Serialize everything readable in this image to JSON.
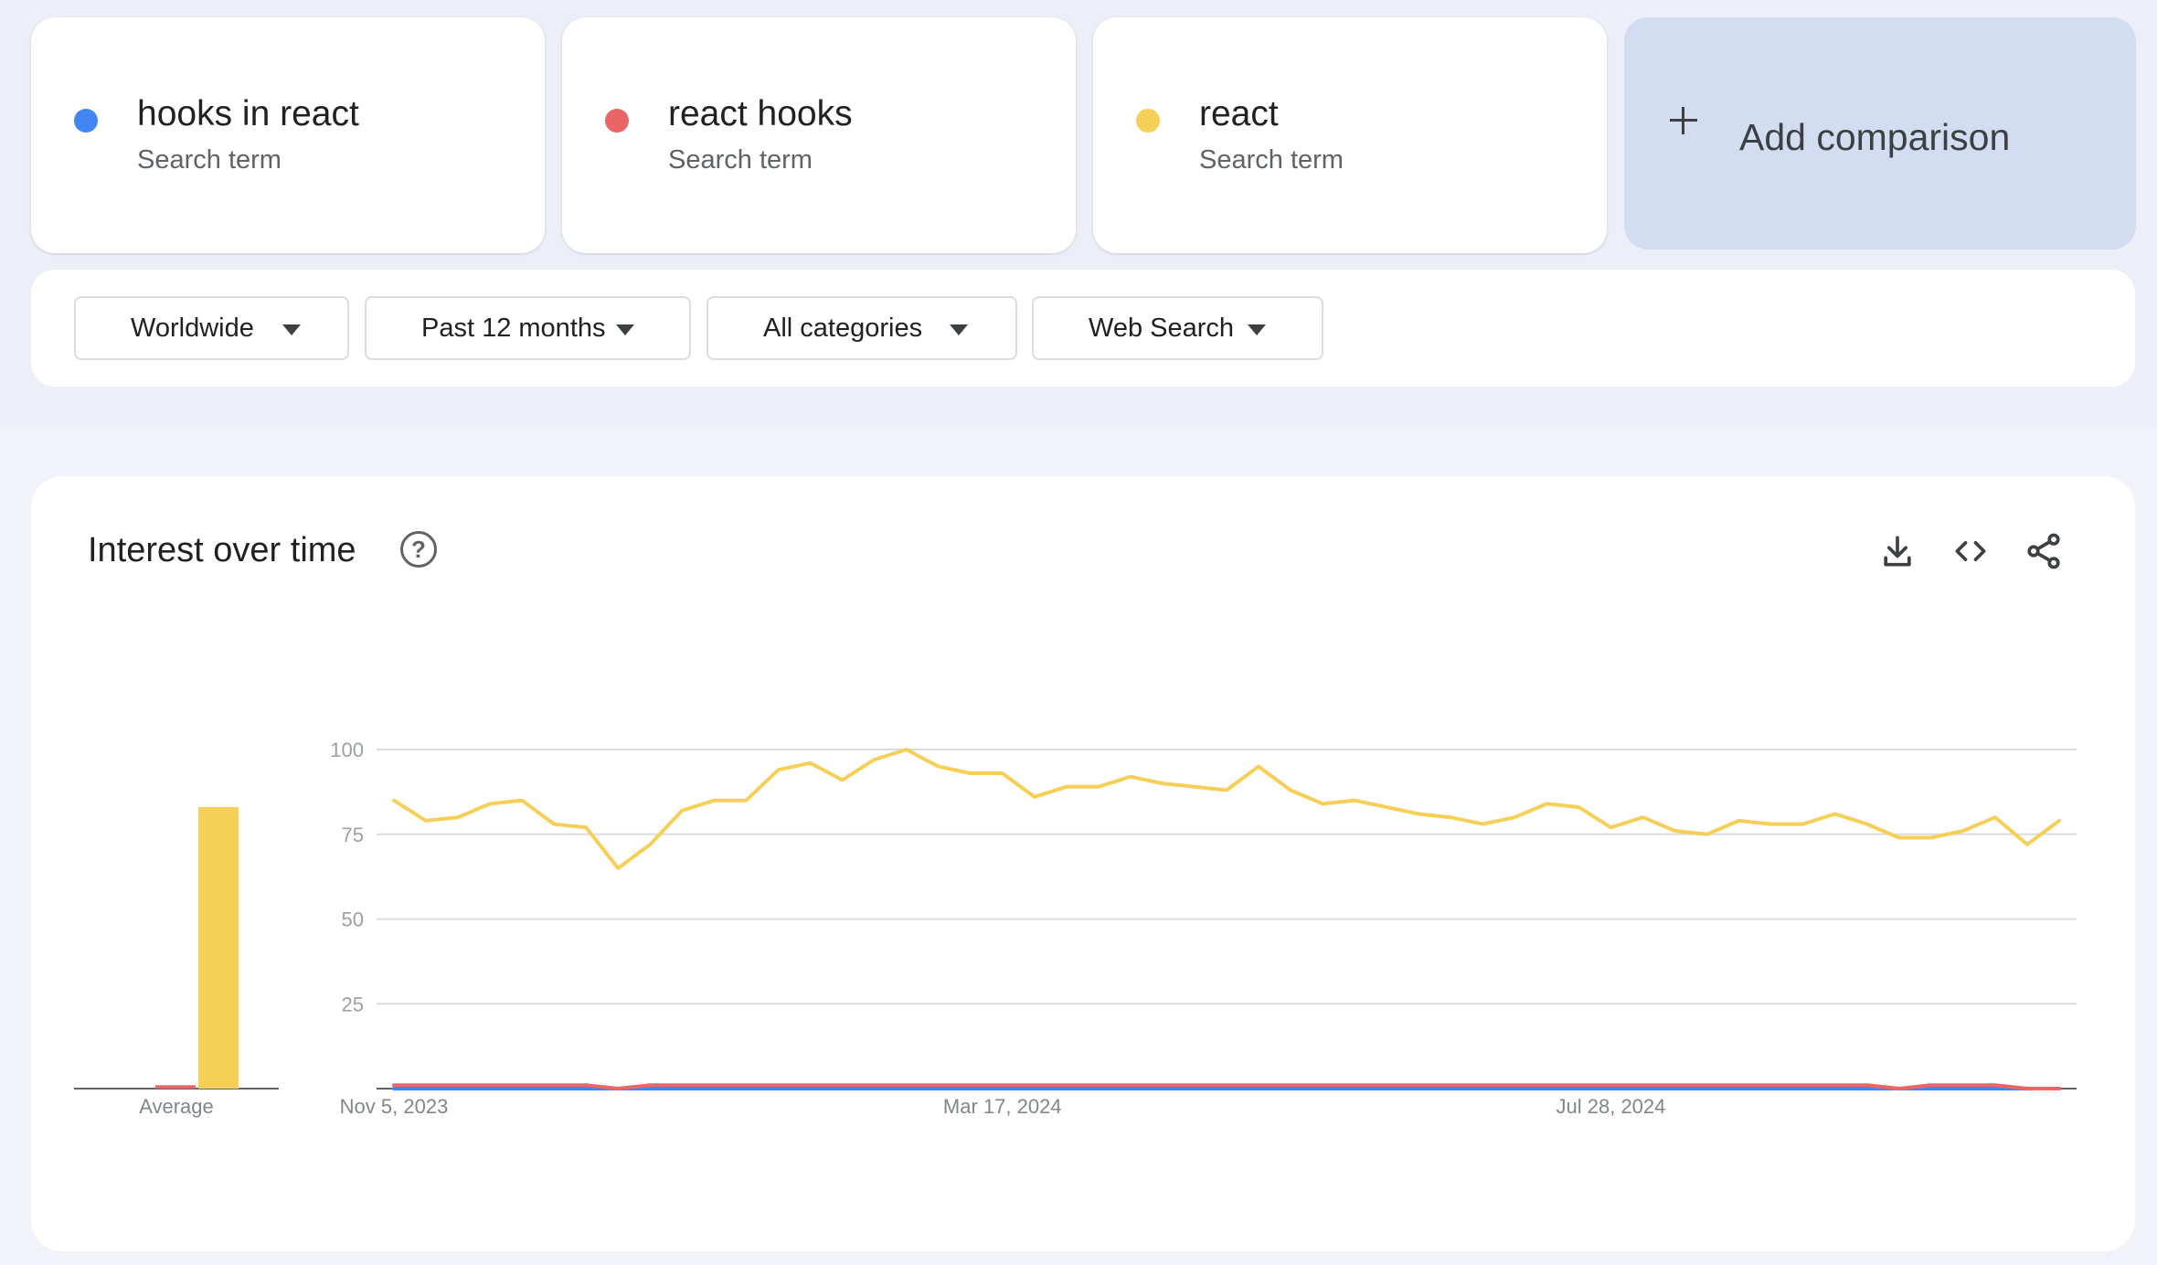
{
  "terms": [
    {
      "name": "hooks in react",
      "subtitle": "Search term",
      "color": "#4285f4"
    },
    {
      "name": "react hooks",
      "subtitle": "Search term",
      "color": "#ea6565"
    },
    {
      "name": "react",
      "subtitle": "Search term",
      "color": "#f6cf57"
    }
  ],
  "add_comparison": {
    "label": "Add comparison",
    "icon": "plus-icon"
  },
  "filters": [
    {
      "label": "Worldwide"
    },
    {
      "label": "Past 12 months"
    },
    {
      "label": "All categories"
    },
    {
      "label": "Web Search"
    }
  ],
  "card": {
    "title": "Interest over time",
    "icons": [
      "help-icon",
      "download-icon",
      "embed-code-icon",
      "share-icon"
    ]
  },
  "chart_data": {
    "type": "line",
    "title": "",
    "xlabel": "",
    "ylabel": "",
    "ylim": [
      0,
      100
    ],
    "yticks": [
      25,
      50,
      75,
      100
    ],
    "grid": true,
    "x_tick_labels": [
      {
        "label": "Nov 5, 2023",
        "index": 0
      },
      {
        "label": "Mar 17, 2024",
        "index": 19
      },
      {
        "label": "Jul 28, 2024",
        "index": 38
      }
    ],
    "series": [
      {
        "name": "react",
        "color": "#f6cf57",
        "values": [
          85,
          79,
          80,
          84,
          85,
          78,
          77,
          65,
          72,
          82,
          85,
          85,
          94,
          96,
          91,
          97,
          100,
          95,
          93,
          93,
          86,
          89,
          89,
          92,
          90,
          89,
          88,
          95,
          88,
          84,
          85,
          83,
          81,
          80,
          78,
          80,
          84,
          83,
          77,
          80,
          76,
          75,
          79,
          78,
          78,
          81,
          78,
          74,
          74,
          76,
          80,
          72,
          79
        ]
      },
      {
        "name": "react hooks",
        "color": "#ea6565",
        "values": [
          1,
          1,
          1,
          1,
          1,
          1,
          1,
          0,
          1,
          1,
          1,
          1,
          1,
          1,
          1,
          1,
          1,
          1,
          1,
          1,
          1,
          1,
          1,
          1,
          1,
          1,
          1,
          1,
          1,
          1,
          1,
          1,
          1,
          1,
          1,
          1,
          1,
          1,
          1,
          1,
          1,
          1,
          1,
          1,
          1,
          1,
          1,
          0,
          1,
          1,
          1,
          0,
          0
        ]
      },
      {
        "name": "hooks in react",
        "color": "#4285f4",
        "values": [
          0,
          0,
          0,
          0,
          0,
          0,
          0,
          0,
          0,
          0,
          0,
          0,
          0,
          0,
          0,
          0,
          0,
          0,
          0,
          0,
          0,
          0,
          0,
          0,
          0,
          0,
          0,
          0,
          0,
          0,
          0,
          0,
          0,
          0,
          0,
          0,
          0,
          0,
          0,
          0,
          0,
          0,
          0,
          0,
          0,
          0,
          0,
          0,
          0,
          0,
          0,
          0,
          0
        ]
      }
    ],
    "average": {
      "label": "Average",
      "values": [
        {
          "name": "hooks in react",
          "value": 0
        },
        {
          "name": "react hooks",
          "value": 1
        },
        {
          "name": "react",
          "value": 83
        }
      ]
    }
  }
}
